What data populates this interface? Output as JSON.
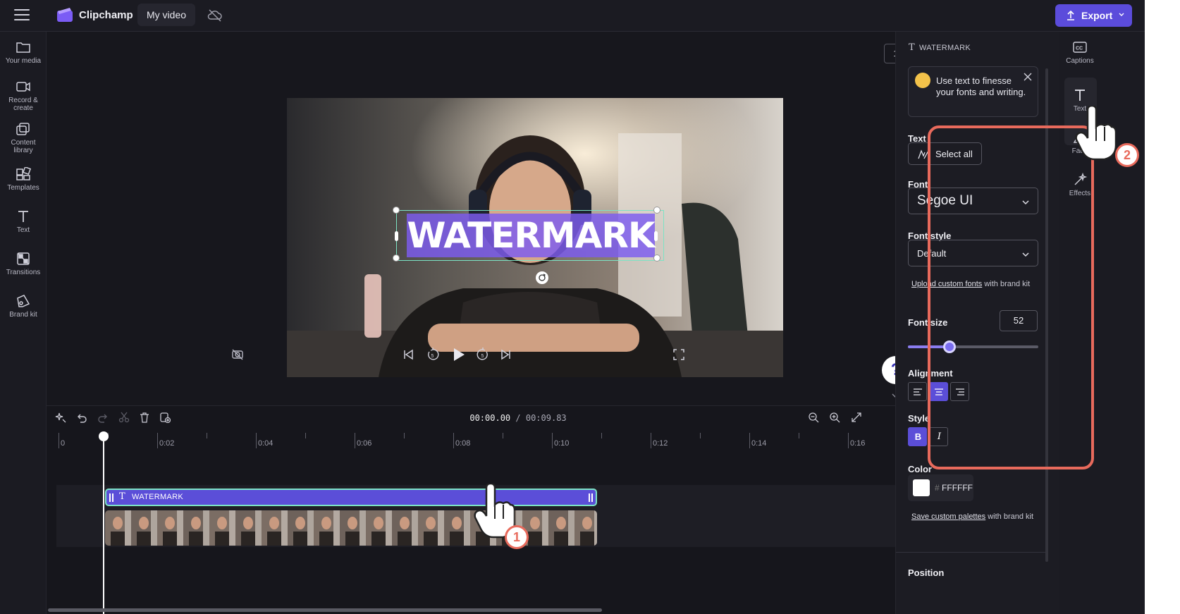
{
  "app": {
    "name": "Clipchamp",
    "video_title": "My video",
    "export_label": "Export",
    "brand_color": "#5b4cdb"
  },
  "left_nav": [
    {
      "label": "Your media",
      "icon": "folder-icon"
    },
    {
      "label": "Record & create",
      "icon": "camera-icon"
    },
    {
      "label": "Content library",
      "icon": "library-icon"
    },
    {
      "label": "Templates",
      "icon": "templates-icon"
    },
    {
      "label": "Text",
      "icon": "text-icon"
    },
    {
      "label": "Transitions",
      "icon": "transitions-icon"
    },
    {
      "label": "Brand kit",
      "icon": "brand-kit-icon"
    }
  ],
  "preview": {
    "aspect_ratio": "16:9",
    "overlay_text": "WATERMARK",
    "highlight_color": "#7c5cf0"
  },
  "timeline": {
    "current_time": "00:00.00",
    "total_time": "/ 00:09.83",
    "ruler_labels": [
      "0",
      "0:02",
      "0:04",
      "0:06",
      "0:08",
      "0:10",
      "0:12",
      "0:14",
      "0:16"
    ],
    "text_clip_label": "WATERMARK"
  },
  "text_panel": {
    "header": "WATERMARK",
    "tip": "Use text to finesse your fonts and writing.",
    "text_label": "Text",
    "select_all": "Select all",
    "font_label": "Font",
    "font_value": "Segoe UI",
    "font_style_label": "Font style",
    "font_style_value": "Default",
    "upload_link": "Upload custom fonts",
    "upload_rest": " with brand kit",
    "font_size_label": "Font size",
    "font_size_value": "52",
    "font_size_fraction": 0.32,
    "alignment_label": "Alignment",
    "alignment_selected": "center",
    "style_label": "Style",
    "bold_glyph": "B",
    "italic_glyph": "I",
    "bold_on": true,
    "color_label": "Color",
    "color_hash": "#",
    "color_value": "FFFFFF",
    "palette_link": "Save custom palettes",
    "palette_rest": " with brand kit",
    "position_label": "Position"
  },
  "right_tabs": [
    {
      "label": "Captions",
      "icon": "captions-icon"
    },
    {
      "label": "Text",
      "icon": "text-icon"
    },
    {
      "label": "Fade",
      "icon": "fade-icon"
    },
    {
      "label": "Effects",
      "icon": "effects-icon"
    }
  ],
  "callouts": [
    "1",
    "2"
  ],
  "callout_color": "#e86a5c"
}
